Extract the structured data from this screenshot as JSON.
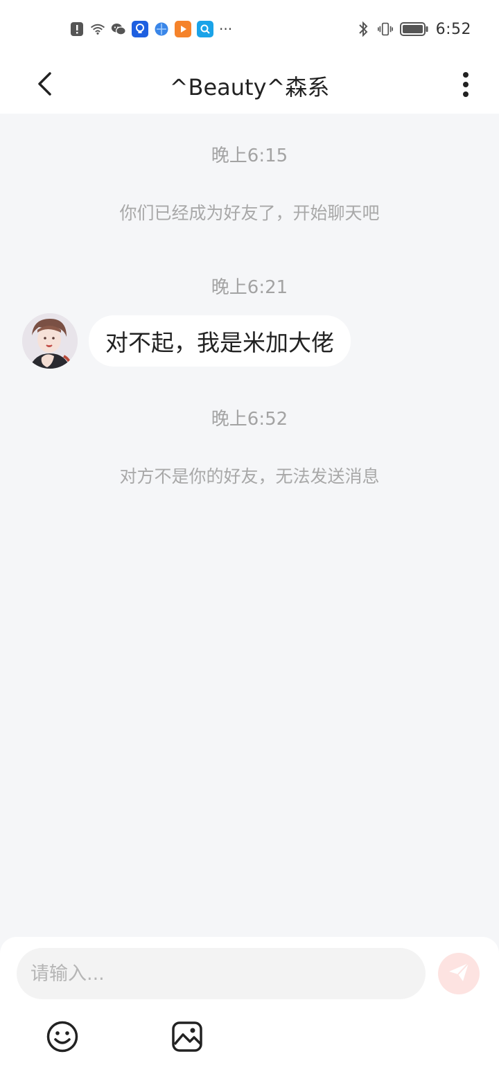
{
  "status_bar": {
    "time": "6:52",
    "left_icons": [
      "alert-icon",
      "wifi-icon",
      "wechat-icon",
      "bulb-app-icon",
      "browser-app-icon",
      "play-app-icon",
      "search-app-icon"
    ],
    "overflow": "···",
    "right_icons": [
      "bluetooth-icon",
      "vibrate-icon",
      "battery-icon"
    ]
  },
  "header": {
    "title": "^Beauty^森系"
  },
  "chat": {
    "items": [
      {
        "type": "timestamp",
        "text": "晚上6:15"
      },
      {
        "type": "system",
        "text": "你们已经成为好友了，开始聊天吧"
      },
      {
        "type": "timestamp",
        "text": "晚上6:21"
      },
      {
        "type": "message",
        "text": "对不起，我是米加大佬"
      },
      {
        "type": "timestamp",
        "text": "晚上6:52"
      },
      {
        "type": "system",
        "text": "对方不是你的好友，无法发送消息"
      }
    ]
  },
  "composer": {
    "placeholder": "请输入...",
    "value": "",
    "tools": [
      "emoji-icon",
      "image-icon"
    ]
  },
  "colors": {
    "background": "#f5f6f8",
    "bubble": "#ffffff",
    "send_button": "#fde3e1",
    "send_icon": "#ffffff",
    "muted_text": "#a3a3a3"
  }
}
